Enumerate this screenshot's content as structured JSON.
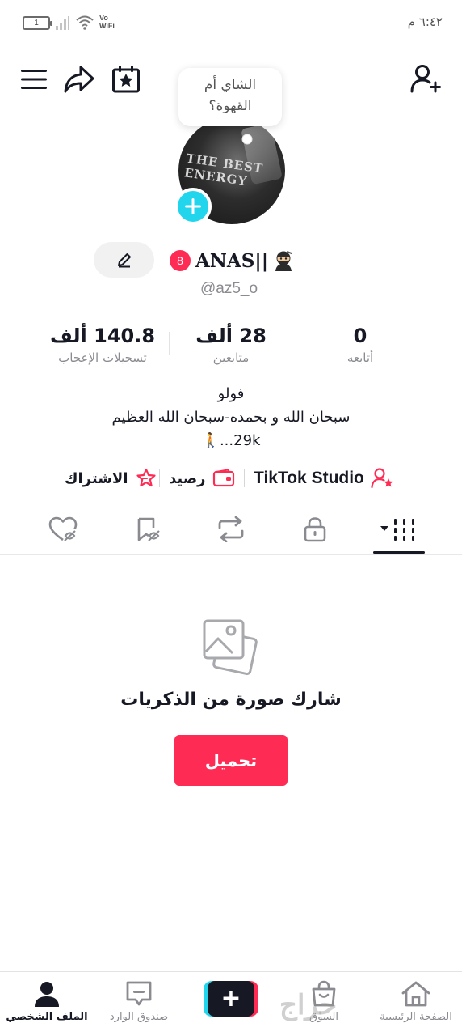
{
  "status_bar": {
    "battery": "1",
    "network": "Vo\nWiFi",
    "network_line1": "Vo",
    "network_line2": "WiFi",
    "time": "٦:٤٢ م"
  },
  "header": {
    "tooltip_line1": "الشاي أم",
    "tooltip_line2": "القهوة؟"
  },
  "profile": {
    "notification_count": "8",
    "display_name": "ANAS||",
    "handle": "@az5_o",
    "avatar_shirt_line1": "THE BEST",
    "avatar_shirt_line2": "ENERGY"
  },
  "stats": [
    {
      "value": "140.8 ألف",
      "label": "تسجيلات الإعجاب"
    },
    {
      "value": "28 ألف",
      "label": "متابعين"
    },
    {
      "value": "0",
      "label": "أتابعه"
    }
  ],
  "bio": {
    "line1": "فولو",
    "line2": "سبحان الله و بحمده-سبحان الله العظيم",
    "line3": "29k...🚶"
  },
  "quick_links": {
    "subscribe": "الاشتراك",
    "balance": "رصيد",
    "studio": "TikTok Studio"
  },
  "empty_state": {
    "title": "شارك صورة من الذكريات",
    "upload_label": "تحميل"
  },
  "bottom_nav": {
    "home": "الصفحة الرئيسية",
    "shop": "السوق",
    "create": "+",
    "inbox": "صندوق الوارد",
    "profile": "الملف الشخصي"
  },
  "watermark": "حراج",
  "colors": {
    "accent": "#fe2c55",
    "cyan": "#20d5ec",
    "text": "#161823",
    "muted": "#8a8b91"
  }
}
